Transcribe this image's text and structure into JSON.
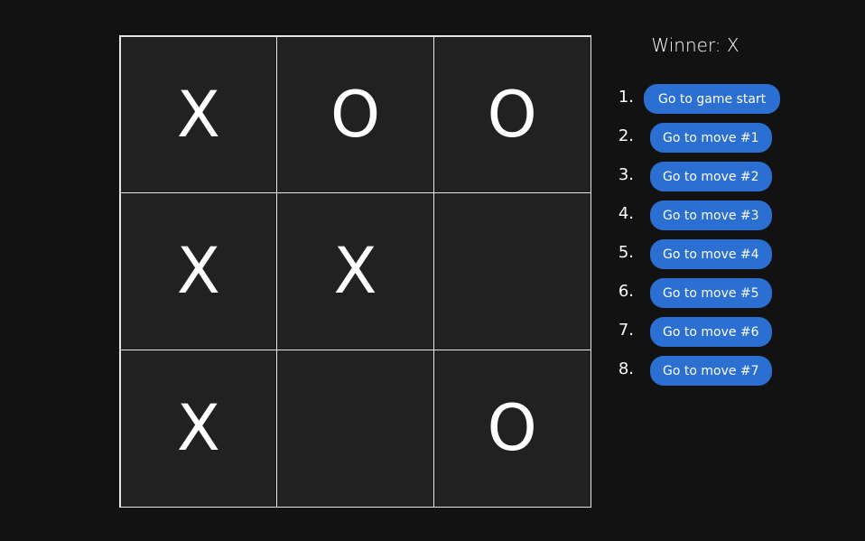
{
  "board": {
    "squares": [
      "X",
      "O",
      "O",
      "X",
      "X",
      "",
      "X",
      "",
      "O"
    ]
  },
  "status": "Winner: X",
  "moves": [
    {
      "number": "1.",
      "label": "Go to game start"
    },
    {
      "number": "2.",
      "label": "Go to move #1"
    },
    {
      "number": "3.",
      "label": "Go to move #2"
    },
    {
      "number": "4.",
      "label": "Go to move #3"
    },
    {
      "number": "5.",
      "label": "Go to move #4"
    },
    {
      "number": "6.",
      "label": "Go to move #5"
    },
    {
      "number": "7.",
      "label": "Go to move #6"
    },
    {
      "number": "8.",
      "label": "Go to move #7"
    }
  ],
  "colors": {
    "background": "#121212",
    "square": "#212121",
    "grid_line": "#e6e6e6",
    "button": "#2a6fd1",
    "text": "#ffffff"
  }
}
